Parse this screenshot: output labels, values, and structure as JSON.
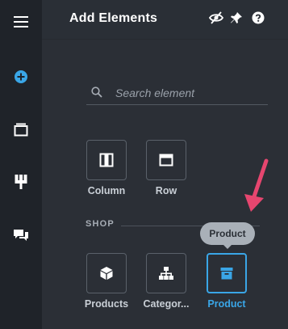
{
  "rail": {
    "items": [
      {
        "name": "menu-icon"
      },
      {
        "name": "add-circle-icon"
      },
      {
        "name": "layers-icon"
      },
      {
        "name": "template-icon"
      },
      {
        "name": "comments-icon"
      }
    ]
  },
  "header": {
    "title": "Add Elements",
    "icons": [
      "eye-off-icon",
      "pin-icon",
      "help-icon"
    ]
  },
  "panel": {
    "search": {
      "placeholder": "Search element"
    },
    "layout_items": [
      {
        "label": "Column",
        "icon": "column-layout-icon"
      },
      {
        "label": "Row",
        "icon": "row-layout-icon"
      }
    ],
    "section_title": "SHOP",
    "shop_items": [
      {
        "label": "Products",
        "icon": "cube-icon"
      },
      {
        "label": "Categor...",
        "icon": "category-tree-icon"
      },
      {
        "label": "Product",
        "icon": "product-box-icon",
        "active": true
      }
    ],
    "tooltip": "Product"
  },
  "colors": {
    "accent": "#3aa6e7",
    "annotation_arrow": "#e6466f",
    "rail_bg": "#1f2329",
    "panel_bg": "#2b2f36"
  }
}
